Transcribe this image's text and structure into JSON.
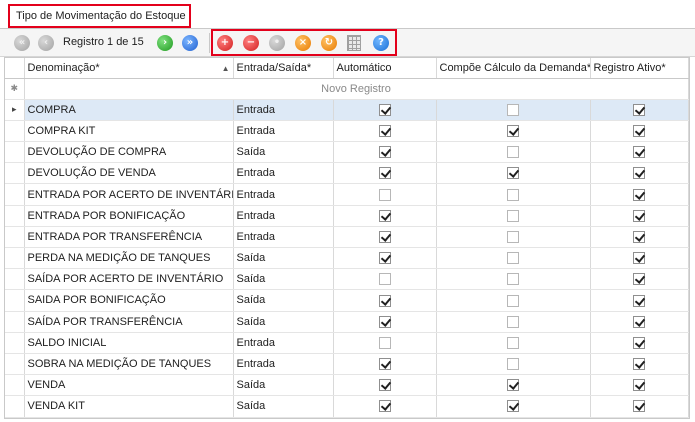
{
  "tab": {
    "title": "Tipo de Movimentação do Estoque"
  },
  "toolbar": {
    "record_label": "Registro 1 de 15",
    "buttons": [
      {
        "name": "first-record",
        "icon": "nav-first-icon",
        "state": "disabled"
      },
      {
        "name": "previous-record",
        "icon": "nav-previous-icon",
        "state": "disabled"
      },
      {
        "name": "next-record",
        "icon": "nav-next-icon",
        "state": "enabled"
      },
      {
        "name": "last-record",
        "icon": "nav-last-icon",
        "state": "enabled"
      },
      {
        "name": "add",
        "icon": "add-icon"
      },
      {
        "name": "delete",
        "icon": "delete-icon"
      },
      {
        "name": "edit",
        "icon": "edit-icon",
        "state": "disabled"
      },
      {
        "name": "cancel",
        "icon": "cancel-icon"
      },
      {
        "name": "refresh",
        "icon": "refresh-icon"
      },
      {
        "name": "export",
        "icon": "spreadsheet-icon"
      },
      {
        "name": "help",
        "icon": "help-icon"
      }
    ]
  },
  "grid": {
    "columns": [
      "Denominação*",
      "Entrada/Saída*",
      "Automático",
      "Compõe Cálculo da Demanda*",
      "Registro Ativo*"
    ],
    "new_row_text": "Novo Registro",
    "rows": [
      {
        "name": "COMPRA",
        "type": "Entrada",
        "auto": true,
        "demand": false,
        "active": true
      },
      {
        "name": "COMPRA KIT",
        "type": "Entrada",
        "auto": true,
        "demand": true,
        "active": true
      },
      {
        "name": "DEVOLUÇÃO DE COMPRA",
        "type": "Saída",
        "auto": true,
        "demand": false,
        "active": true
      },
      {
        "name": "DEVOLUÇÃO DE VENDA",
        "type": "Entrada",
        "auto": true,
        "demand": true,
        "active": true
      },
      {
        "name": "ENTRADA POR ACERTO DE INVENTÁRIO",
        "type": "Entrada",
        "auto": false,
        "demand": false,
        "active": true
      },
      {
        "name": "ENTRADA POR BONIFICAÇÃO",
        "type": "Entrada",
        "auto": true,
        "demand": false,
        "active": true
      },
      {
        "name": "ENTRADA POR TRANSFERÊNCIA",
        "type": "Entrada",
        "auto": true,
        "demand": false,
        "active": true
      },
      {
        "name": "PERDA NA MEDIÇÃO DE TANQUES",
        "type": "Saída",
        "auto": true,
        "demand": false,
        "active": true
      },
      {
        "name": "SAÍDA POR ACERTO DE INVENTÁRIO",
        "type": "Saída",
        "auto": false,
        "demand": false,
        "active": true
      },
      {
        "name": "SAIDA POR BONIFICAÇÃO",
        "type": "Saída",
        "auto": true,
        "demand": false,
        "active": true
      },
      {
        "name": "SAÍDA POR TRANSFERÊNCIA",
        "type": "Saída",
        "auto": true,
        "demand": false,
        "active": true
      },
      {
        "name": "SALDO INICIAL",
        "type": "Entrada",
        "auto": false,
        "demand": false,
        "active": true
      },
      {
        "name": "SOBRA NA MEDIÇÃO DE TANQUES",
        "type": "Entrada",
        "auto": true,
        "demand": false,
        "active": true
      },
      {
        "name": "VENDA",
        "type": "Saída",
        "auto": true,
        "demand": true,
        "active": true
      },
      {
        "name": "VENDA KIT",
        "type": "Saída",
        "auto": true,
        "demand": true,
        "active": true
      }
    ]
  }
}
